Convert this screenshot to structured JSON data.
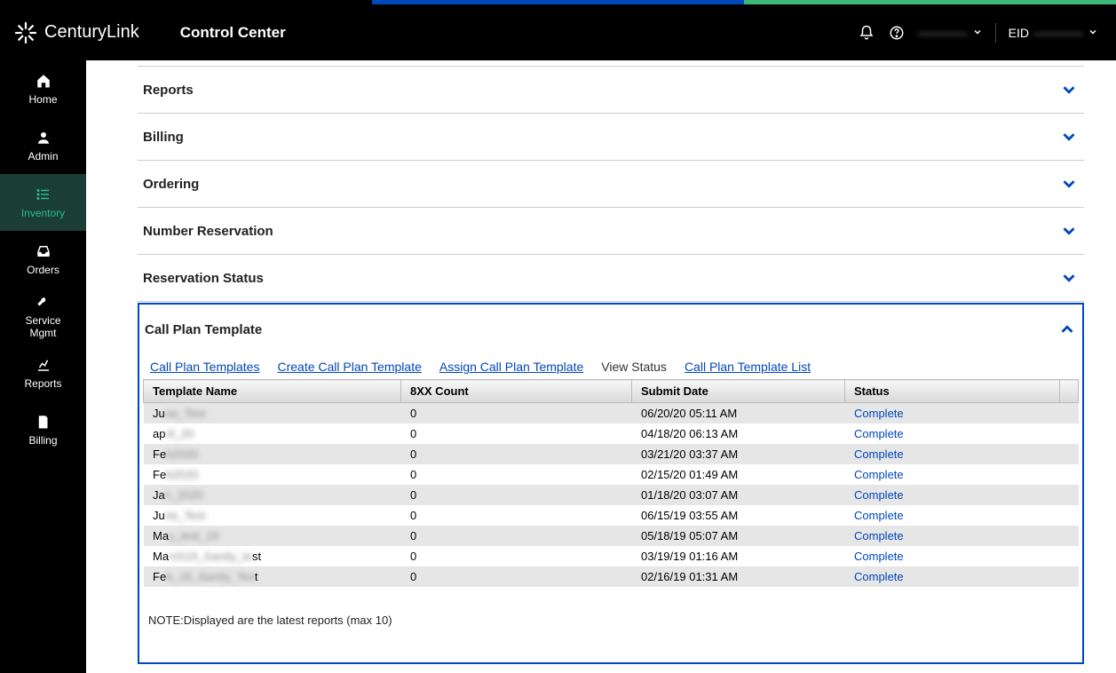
{
  "brand": {
    "name": "CenturyLink",
    "product": "Control Center"
  },
  "header": {
    "user": "————",
    "eid_label": "EID",
    "eid_value": "————"
  },
  "sidebar": {
    "items": [
      {
        "label": "Home"
      },
      {
        "label": "Admin"
      },
      {
        "label": "Inventory"
      },
      {
        "label": "Orders"
      },
      {
        "label": "Service\nMgmt"
      },
      {
        "label": "Reports"
      },
      {
        "label": "Billing"
      }
    ]
  },
  "accordions": {
    "reports": "Reports",
    "billing": "Billing",
    "ordering": "Ordering",
    "number_reservation": "Number Reservation",
    "reservation_status": "Reservation Status",
    "call_plan_template": "Call Plan Template"
  },
  "subtabs": {
    "call_plan_templates": "Call Plan Templates",
    "create": "Create Call Plan Template",
    "assign": "Assign Call Plan Template",
    "view_status": "View Status",
    "list": "Call Plan Template List"
  },
  "table": {
    "columns": {
      "template_name": "Template Name",
      "count": "8XX Count",
      "submit_date": "Submit Date",
      "status": "Status"
    },
    "rows": [
      {
        "name_prefix": "Ju",
        "name_blur": "ne_Test",
        "count": "0",
        "date": "06/20/20 05:11 AM",
        "status": "Complete"
      },
      {
        "name_prefix": "ap",
        "name_blur": "ril_20",
        "count": "0",
        "date": "04/18/20 06:13 AM",
        "status": "Complete"
      },
      {
        "name_prefix": "Fe",
        "name_blur": "b2020",
        "count": "0",
        "date": "03/21/20 03:37 AM",
        "status": "Complete"
      },
      {
        "name_prefix": "Fe",
        "name_blur": "b2020",
        "count": "0",
        "date": "02/15/20 01:49 AM",
        "status": "Complete"
      },
      {
        "name_prefix": "Ja",
        "name_blur": "n_2020",
        "count": "0",
        "date": "01/18/20 03:07 AM",
        "status": "Complete"
      },
      {
        "name_prefix": "Ju",
        "name_blur": "ne_Test",
        "count": "0",
        "date": "06/15/19 03:55 AM",
        "status": "Complete"
      },
      {
        "name_prefix": "Ma",
        "name_blur": "y_test_19",
        "count": "0",
        "date": "05/18/19 05:07 AM",
        "status": "Complete"
      },
      {
        "name_prefix": "Ma",
        "name_blur": "rch19_Sanity_te",
        "name_suffix": "st",
        "count": "0",
        "date": "03/19/19 01:16 AM",
        "status": "Complete"
      },
      {
        "name_prefix": "Fe",
        "name_blur": "b_19_Sanity_Tes",
        "name_suffix": "t",
        "count": "0",
        "date": "02/16/19 01:31 AM",
        "status": "Complete"
      }
    ],
    "note": "NOTE:Displayed are the latest reports (max 10)"
  }
}
